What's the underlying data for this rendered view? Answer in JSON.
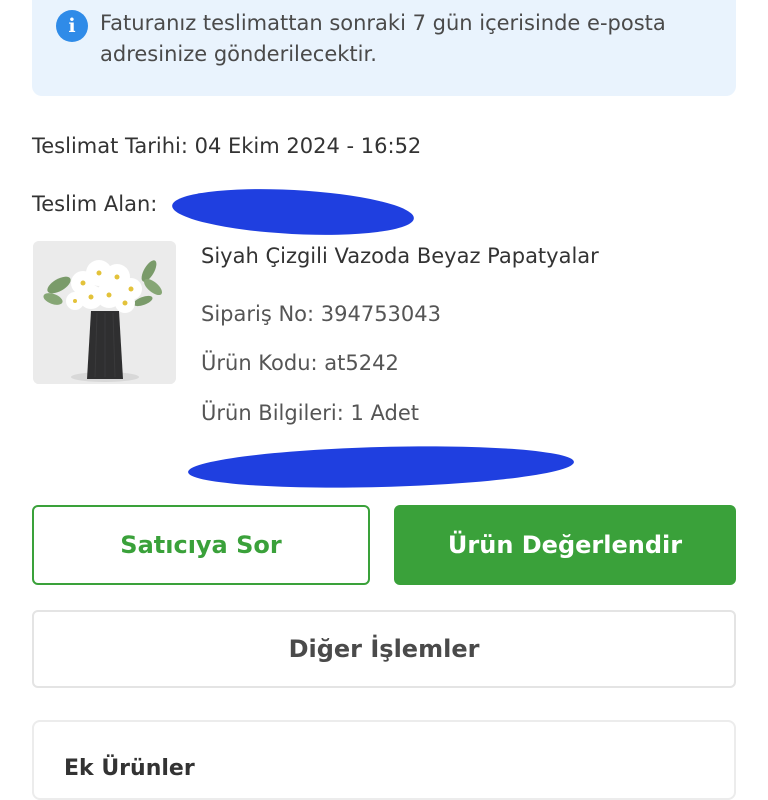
{
  "info_banner": {
    "icon": "info-icon",
    "icon_glyph": "i",
    "text": "Faturanız teslimattan sonraki 7 gün içerisinde e-posta adresinize gönderilecektir."
  },
  "delivery": {
    "date_line": "Teslimat Tarihi: 04 Ekim 2024 - 16:52",
    "receiver_label": "Teslim Alan:"
  },
  "product": {
    "image": "daisies-in-black-vase-image",
    "title": "Siyah Çizgili Vazoda Beyaz Papatyalar",
    "order_no": "Sipariş No: 394753043",
    "product_code": "Ürün Kodu: at5242",
    "product_info": "Ürün Bilgileri: 1 Adet"
  },
  "actions": {
    "ask_seller": "Satıcıya Sor",
    "rate_product": "Ürün Değerlendir",
    "other_actions": "Diğer İşlemler"
  },
  "extras": {
    "title": "Ek Ürünler"
  },
  "colors": {
    "accent_green": "#3aa13a",
    "info_blue": "#2f8be8",
    "banner_bg": "#e9f3fd",
    "redaction": "#1f3fe0"
  }
}
